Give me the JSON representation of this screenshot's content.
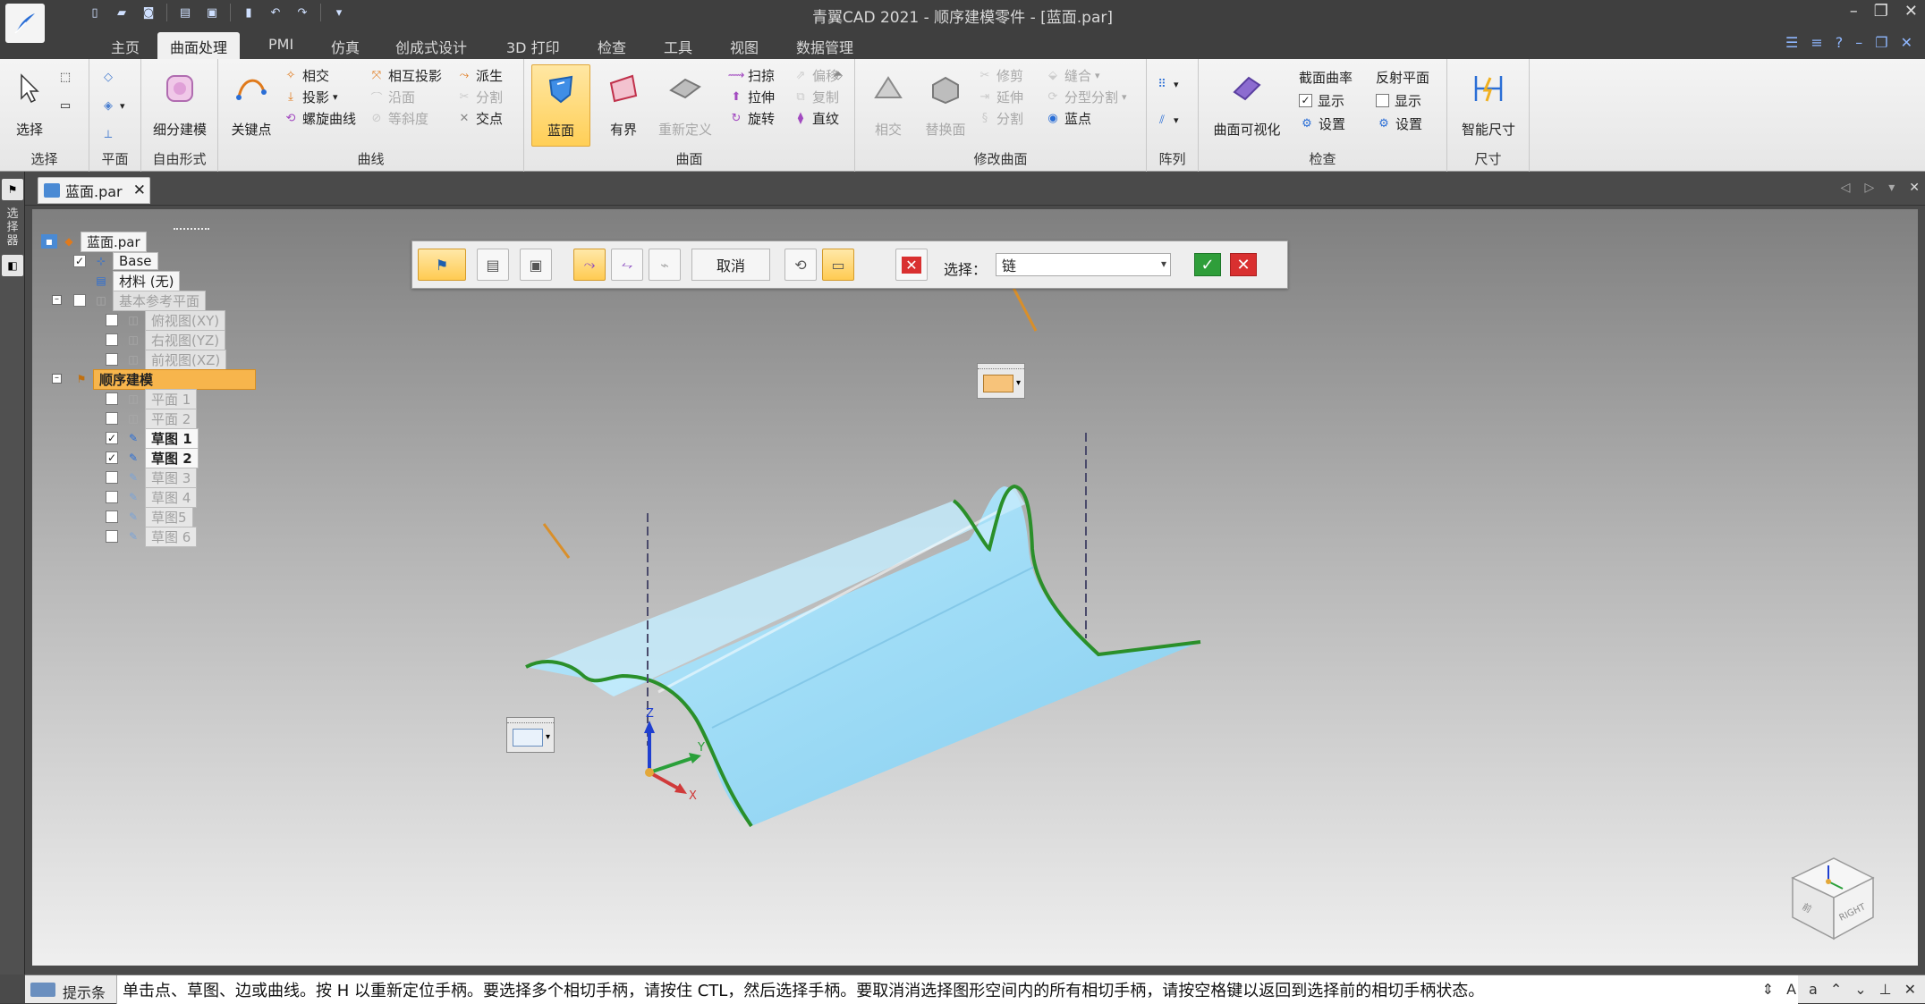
{
  "window": {
    "title": "青翼CAD 2021 - 顺序建模零件 - [蓝面.par]",
    "controls": [
      "–",
      "❐",
      "✕"
    ]
  },
  "ribbon_tabs": [
    {
      "label": "主页"
    },
    {
      "label": "曲面处理"
    },
    {
      "label": "PMI"
    },
    {
      "label": "仿真"
    },
    {
      "label": "创成式设计"
    },
    {
      "label": "3D 打印"
    },
    {
      "label": "检查"
    },
    {
      "label": "工具"
    },
    {
      "label": "视图"
    },
    {
      "label": "数据管理"
    }
  ],
  "ribbon": {
    "select": {
      "button": "选择",
      "group": "选择"
    },
    "plane": {
      "group": "平面"
    },
    "freeform": {
      "button": "细分建模",
      "group": "自由形式"
    },
    "curves": {
      "group": "曲线",
      "keypoint": "关键点",
      "intersect": "相交",
      "project": "投影",
      "helix": "螺旋曲线",
      "cross_project": "相互投影",
      "derive": "派生",
      "along_surface": "沿面",
      "split": "分割",
      "isocline": "等斜度",
      "intersection_point": "交点"
    },
    "surfaces": {
      "group": "曲面",
      "bluesurf": "蓝面",
      "bounded": "有界",
      "redefine": "重新定义",
      "sweep": "扫掠",
      "extrude": "拉伸",
      "revolve": "旋转",
      "offset": "偏移",
      "copy": "复制",
      "ruled": "直纹"
    },
    "modify": {
      "group": "修改曲面",
      "intersect": "相交",
      "replace": "替换面",
      "trim": "修剪",
      "extend": "延伸",
      "split": "分割",
      "stitch": "缝合",
      "split_part": "分型分割",
      "bluedot": "蓝点"
    },
    "pattern": {
      "group": "阵列"
    },
    "inspect": {
      "group": "检查",
      "visualize": "曲面可视化",
      "curvature": "截面曲率",
      "show": "显示",
      "settings": "设置",
      "reflective": "反射平面",
      "show2": "显示",
      "settings2": "设置"
    },
    "dimension": {
      "button": "智能尺寸",
      "group": "尺寸"
    }
  },
  "left_strip": {
    "label": "选择器"
  },
  "doc_tab": {
    "label": "蓝面.par",
    "close": "✕"
  },
  "tree": {
    "root": "蓝面.par",
    "base": "Base",
    "material": "材料 (无)",
    "ref_planes": "基本参考平面",
    "top_view": "俯视图(XY)",
    "right_view": "右视图(YZ)",
    "front_view": "前视图(XZ)",
    "ordered": "顺序建模",
    "items": [
      {
        "label": "平面 1",
        "checked": false,
        "bold": false
      },
      {
        "label": "平面 2",
        "checked": false,
        "bold": false
      },
      {
        "label": "草图 1",
        "checked": true,
        "bold": true
      },
      {
        "label": "草图 2",
        "checked": true,
        "bold": true
      },
      {
        "label": "草图 3",
        "checked": false,
        "bold": false
      },
      {
        "label": "草图 4",
        "checked": false,
        "bold": false
      },
      {
        "label": "草图5",
        "checked": false,
        "bold": false
      },
      {
        "label": "草图 6",
        "checked": false,
        "bold": false
      }
    ]
  },
  "command_bar": {
    "cancel": "取消",
    "select_label": "选择：",
    "select_value": "链",
    "ok": "✓",
    "close": "✕"
  },
  "viewcube": {
    "front": "前",
    "right": "RIGHT"
  },
  "statusbar": {
    "label": "提示条",
    "text": "单击点、草图、边或曲线。按 H 以重新定位手柄。要选择多个相切手柄，请按住 CTL，然后选择手柄。要取消消选择图形空间内的所有相切手柄，请按空格键以返回到选择前的相切手柄状态。"
  }
}
